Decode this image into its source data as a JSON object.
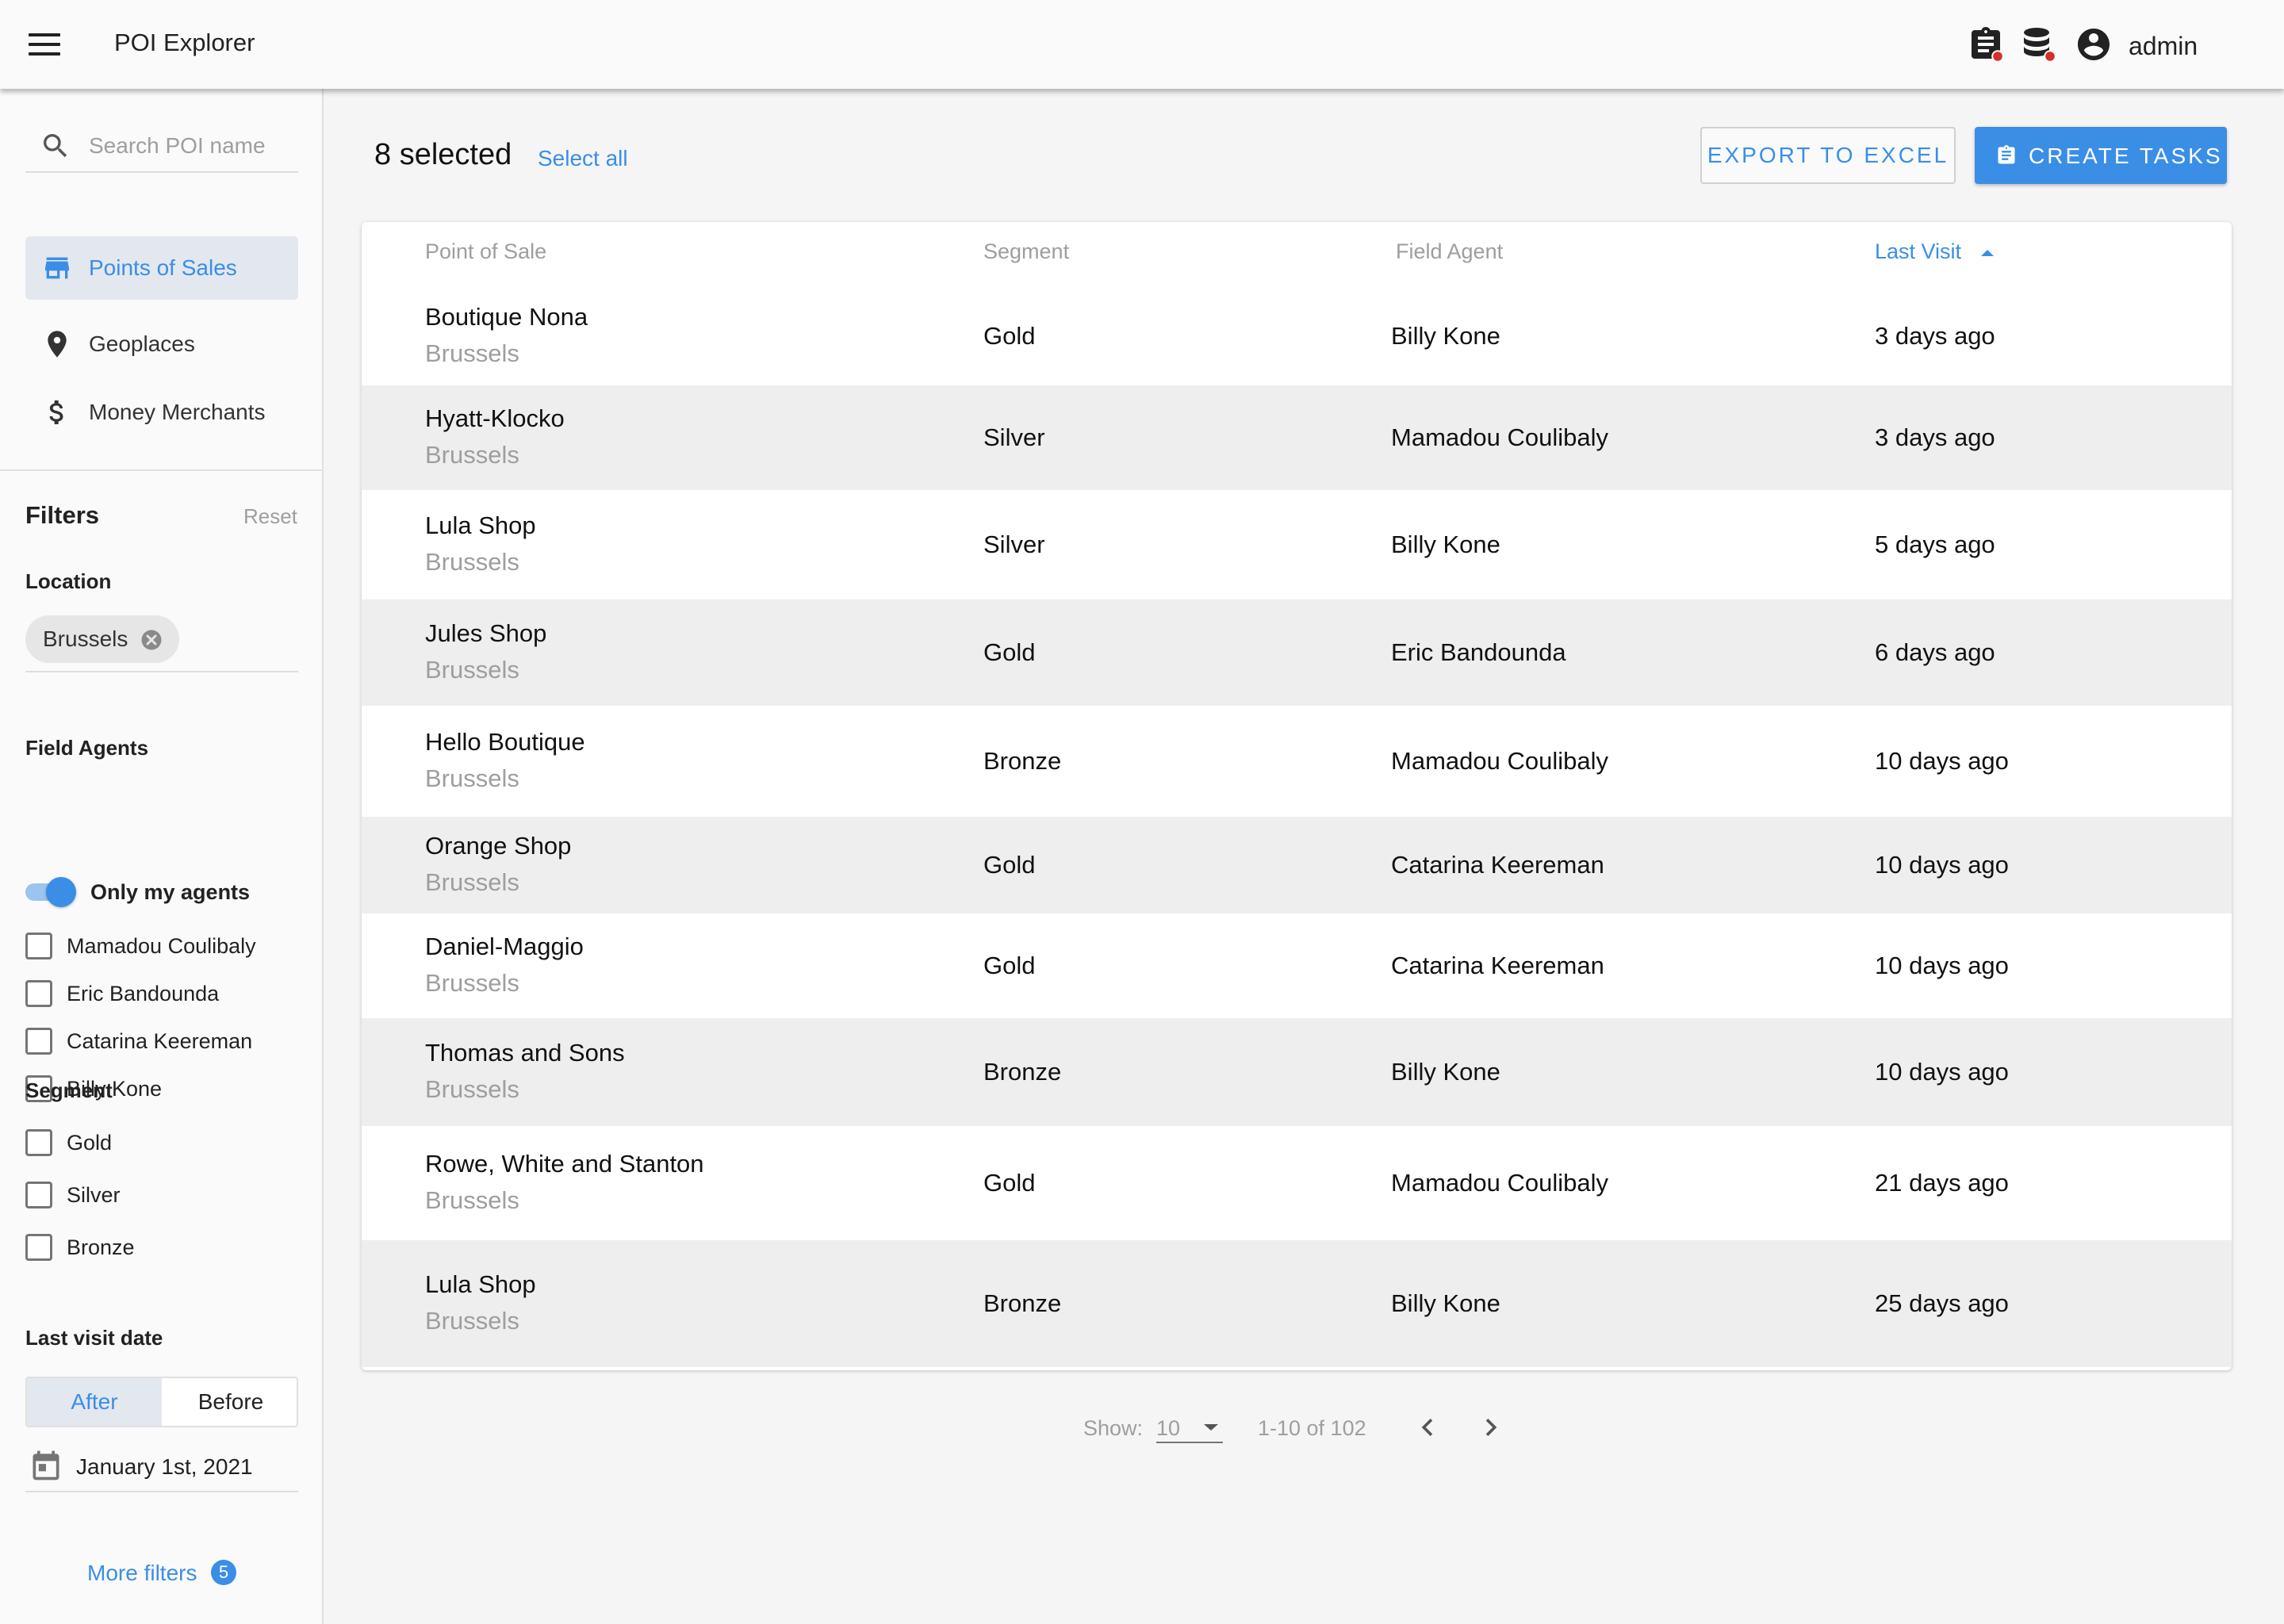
{
  "appbar": {
    "title": "POI Explorer",
    "user": "admin",
    "icons": [
      "menu-icon",
      "clipboard-alert-icon",
      "database-alert-icon",
      "account-circle-icon"
    ]
  },
  "sidebar": {
    "search_placeholder": "Search POI name",
    "nav": [
      {
        "label": "Points of Sales",
        "icon": "store-icon",
        "active": true
      },
      {
        "label": "Geoplaces",
        "icon": "map-pin-icon",
        "active": false
      },
      {
        "label": "Money Merchants",
        "icon": "dollar-icon",
        "active": false
      }
    ],
    "filters_title": "Filters",
    "reset": "Reset",
    "location_title": "Location",
    "location_chip": "Brussels",
    "field_agents_title": "Field Agents",
    "only_my_agents": "Only my agents",
    "only_my_agents_on": true,
    "agents": [
      "Mamadou Coulibaly",
      "Eric Bandounda",
      "Catarina Keereman",
      "Billy Kone"
    ],
    "segment_title": "Segment",
    "segments": [
      "Gold",
      "Silver",
      "Bronze"
    ],
    "last_visit_title": "Last visit date",
    "after": "After",
    "before": "Before",
    "date": "January 1st, 2021",
    "more_filters": "More filters",
    "more_filters_count": "5"
  },
  "main": {
    "selected": "8 selected",
    "select_all": "Select all",
    "export": "EXPORT TO EXCEL",
    "create_tasks": "CREATE TASKS",
    "columns": {
      "pos": "Point of Sale",
      "segment": "Segment",
      "agent": "Field Agent",
      "last_visit": "Last Visit"
    },
    "rows": [
      {
        "name": "Boutique Nona",
        "city": "Brussels",
        "segment": "Gold",
        "agent": "Billy Kone",
        "last_visit": "3 days ago"
      },
      {
        "name": "Hyatt-Klocko",
        "city": "Brussels",
        "segment": "Silver",
        "agent": "Mamadou Coulibaly",
        "last_visit": "3 days ago"
      },
      {
        "name": "Lula Shop",
        "city": "Brussels",
        "segment": "Silver",
        "agent": "Billy Kone",
        "last_visit": "5 days ago"
      },
      {
        "name": "Jules Shop",
        "city": "Brussels",
        "segment": "Gold",
        "agent": "Eric Bandounda",
        "last_visit": "6 days ago"
      },
      {
        "name": "Hello Boutique",
        "city": "Brussels",
        "segment": "Bronze",
        "agent": "Mamadou Coulibaly",
        "last_visit": "10 days ago"
      },
      {
        "name": "Orange Shop",
        "city": "Brussels",
        "segment": "Gold",
        "agent": "Catarina Keereman",
        "last_visit": "10 days ago"
      },
      {
        "name": "Daniel-Maggio",
        "city": "Brussels",
        "segment": "Gold",
        "agent": "Catarina Keereman",
        "last_visit": "10 days ago"
      },
      {
        "name": "Thomas and Sons",
        "city": "Brussels",
        "segment": "Bronze",
        "agent": "Billy Kone",
        "last_visit": "10 days ago"
      },
      {
        "name": "Rowe, White and Stanton",
        "city": "Brussels",
        "segment": "Gold",
        "agent": "Mamadou Coulibaly",
        "last_visit": "21 days ago"
      },
      {
        "name": "Lula Shop",
        "city": "Brussels",
        "segment": "Bronze",
        "agent": "Billy Kone",
        "last_visit": "25 days ago"
      }
    ],
    "pagination": {
      "show_label": "Show:",
      "page_size": "10",
      "range": "1-10 of 102"
    }
  },
  "colors": {
    "accent": "#3a8ee6",
    "alert": "#d32f2f"
  }
}
